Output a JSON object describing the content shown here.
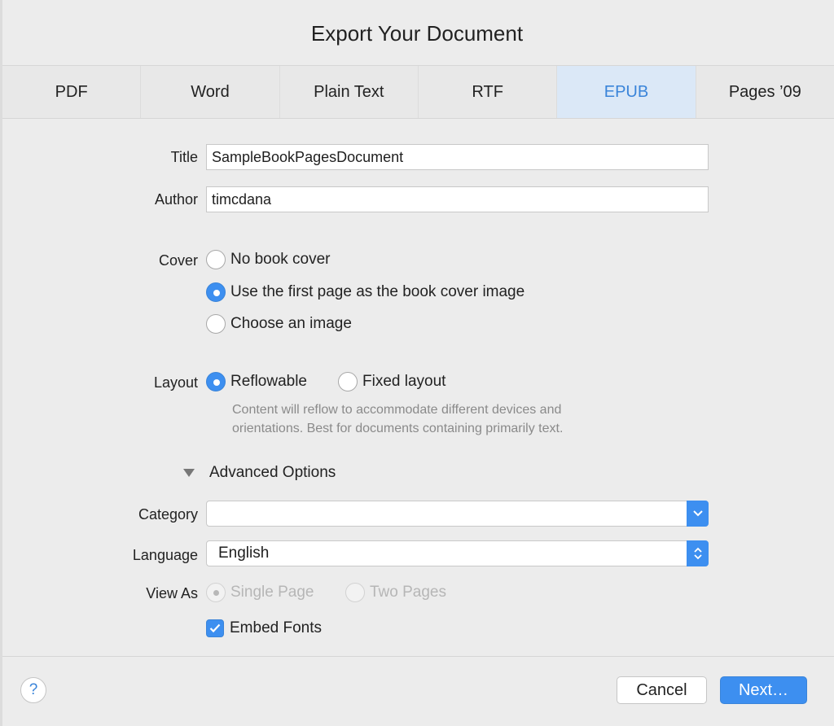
{
  "dialog": {
    "title": "Export Your Document"
  },
  "tabs": [
    {
      "label": "PDF"
    },
    {
      "label": "Word"
    },
    {
      "label": "Plain Text"
    },
    {
      "label": "RTF"
    },
    {
      "label": "EPUB",
      "active": true
    },
    {
      "label": "Pages ’09"
    }
  ],
  "form": {
    "title_label": "Title",
    "title_value": "SampleBookPagesDocument",
    "author_label": "Author",
    "author_value": "timcdana",
    "cover_label": "Cover",
    "cover_options": [
      {
        "label": "No book cover",
        "selected": false
      },
      {
        "label": "Use the first page as the book cover image",
        "selected": true
      },
      {
        "label": "Choose an image",
        "selected": false
      }
    ],
    "layout_label": "Layout",
    "layout_options": [
      {
        "label": "Reflowable",
        "selected": true
      },
      {
        "label": "Fixed layout",
        "selected": false
      }
    ],
    "layout_help_line1": "Content will reflow to accommodate different devices and",
    "layout_help_line2": "orientations. Best for documents containing primarily text."
  },
  "advanced": {
    "label": "Advanced Options",
    "expanded": true,
    "category_label": "Category",
    "category_value": "",
    "language_label": "Language",
    "language_value": "English",
    "view_as_label": "View As",
    "view_as_options": [
      {
        "label": "Single Page",
        "selected": true,
        "disabled": true
      },
      {
        "label": "Two Pages",
        "selected": false,
        "disabled": true
      }
    ],
    "embed_fonts_label": "Embed Fonts",
    "embed_fonts_checked": true
  },
  "footer": {
    "help_label": "?",
    "cancel_label": "Cancel",
    "next_label": "Next…"
  },
  "colors": {
    "accent": "#3d8ff0",
    "active_tab_bg": "#dbe8f7",
    "background": "#ececec"
  }
}
